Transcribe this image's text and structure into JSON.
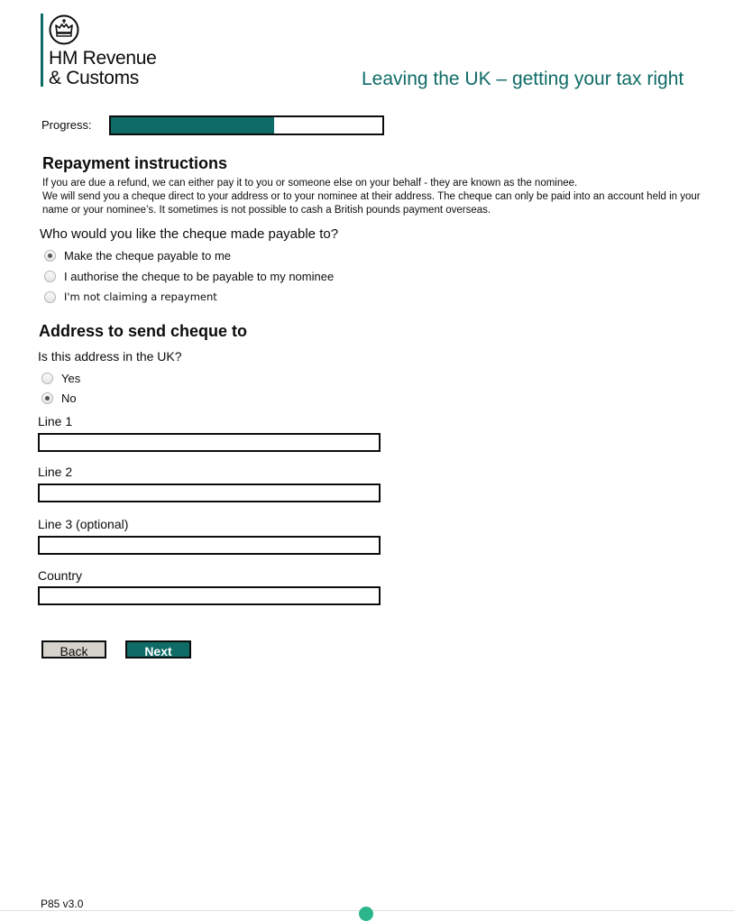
{
  "header": {
    "logo_line1": "HM Revenue",
    "logo_line2": "& Customs",
    "logo_icon": "crown-crest-icon",
    "title": "Leaving the UK – getting your tax right",
    "brand_color": "#0e6b66"
  },
  "progress": {
    "label": "Progress:",
    "fraction": 0.6
  },
  "repayment": {
    "heading": "Repayment instructions",
    "intro_line1": "If you are due a refund, we can either pay it to you or someone else on your behalf - they are known as the nominee.",
    "intro_line2": "We will send you a cheque direct to your address or to your nominee at their address. The cheque can only be paid into an account held in your name or your nominee’s. It sometimes is not possible to cash a British pounds payment overseas.",
    "question": "Who would you like the cheque made payable to?",
    "options": [
      {
        "label": "Make the cheque payable to me",
        "checked": true
      },
      {
        "label": "I authorise the cheque to be payable to my nominee",
        "checked": false
      },
      {
        "label": "I'm not claiming a repayment",
        "checked": false
      }
    ]
  },
  "address": {
    "heading": "Address to send cheque to",
    "question": "Is this address in the UK?",
    "options": [
      {
        "label": "Yes",
        "checked": false
      },
      {
        "label": "No",
        "checked": true
      }
    ],
    "fields": [
      {
        "label": "Line 1",
        "value": ""
      },
      {
        "label": "Line 2",
        "value": ""
      },
      {
        "label": "Line 3 (optional)",
        "value": ""
      },
      {
        "label": "Country",
        "value": ""
      }
    ]
  },
  "buttons": {
    "back": "Back",
    "next": "Next"
  },
  "footer": {
    "version": "P85 v3.0"
  }
}
